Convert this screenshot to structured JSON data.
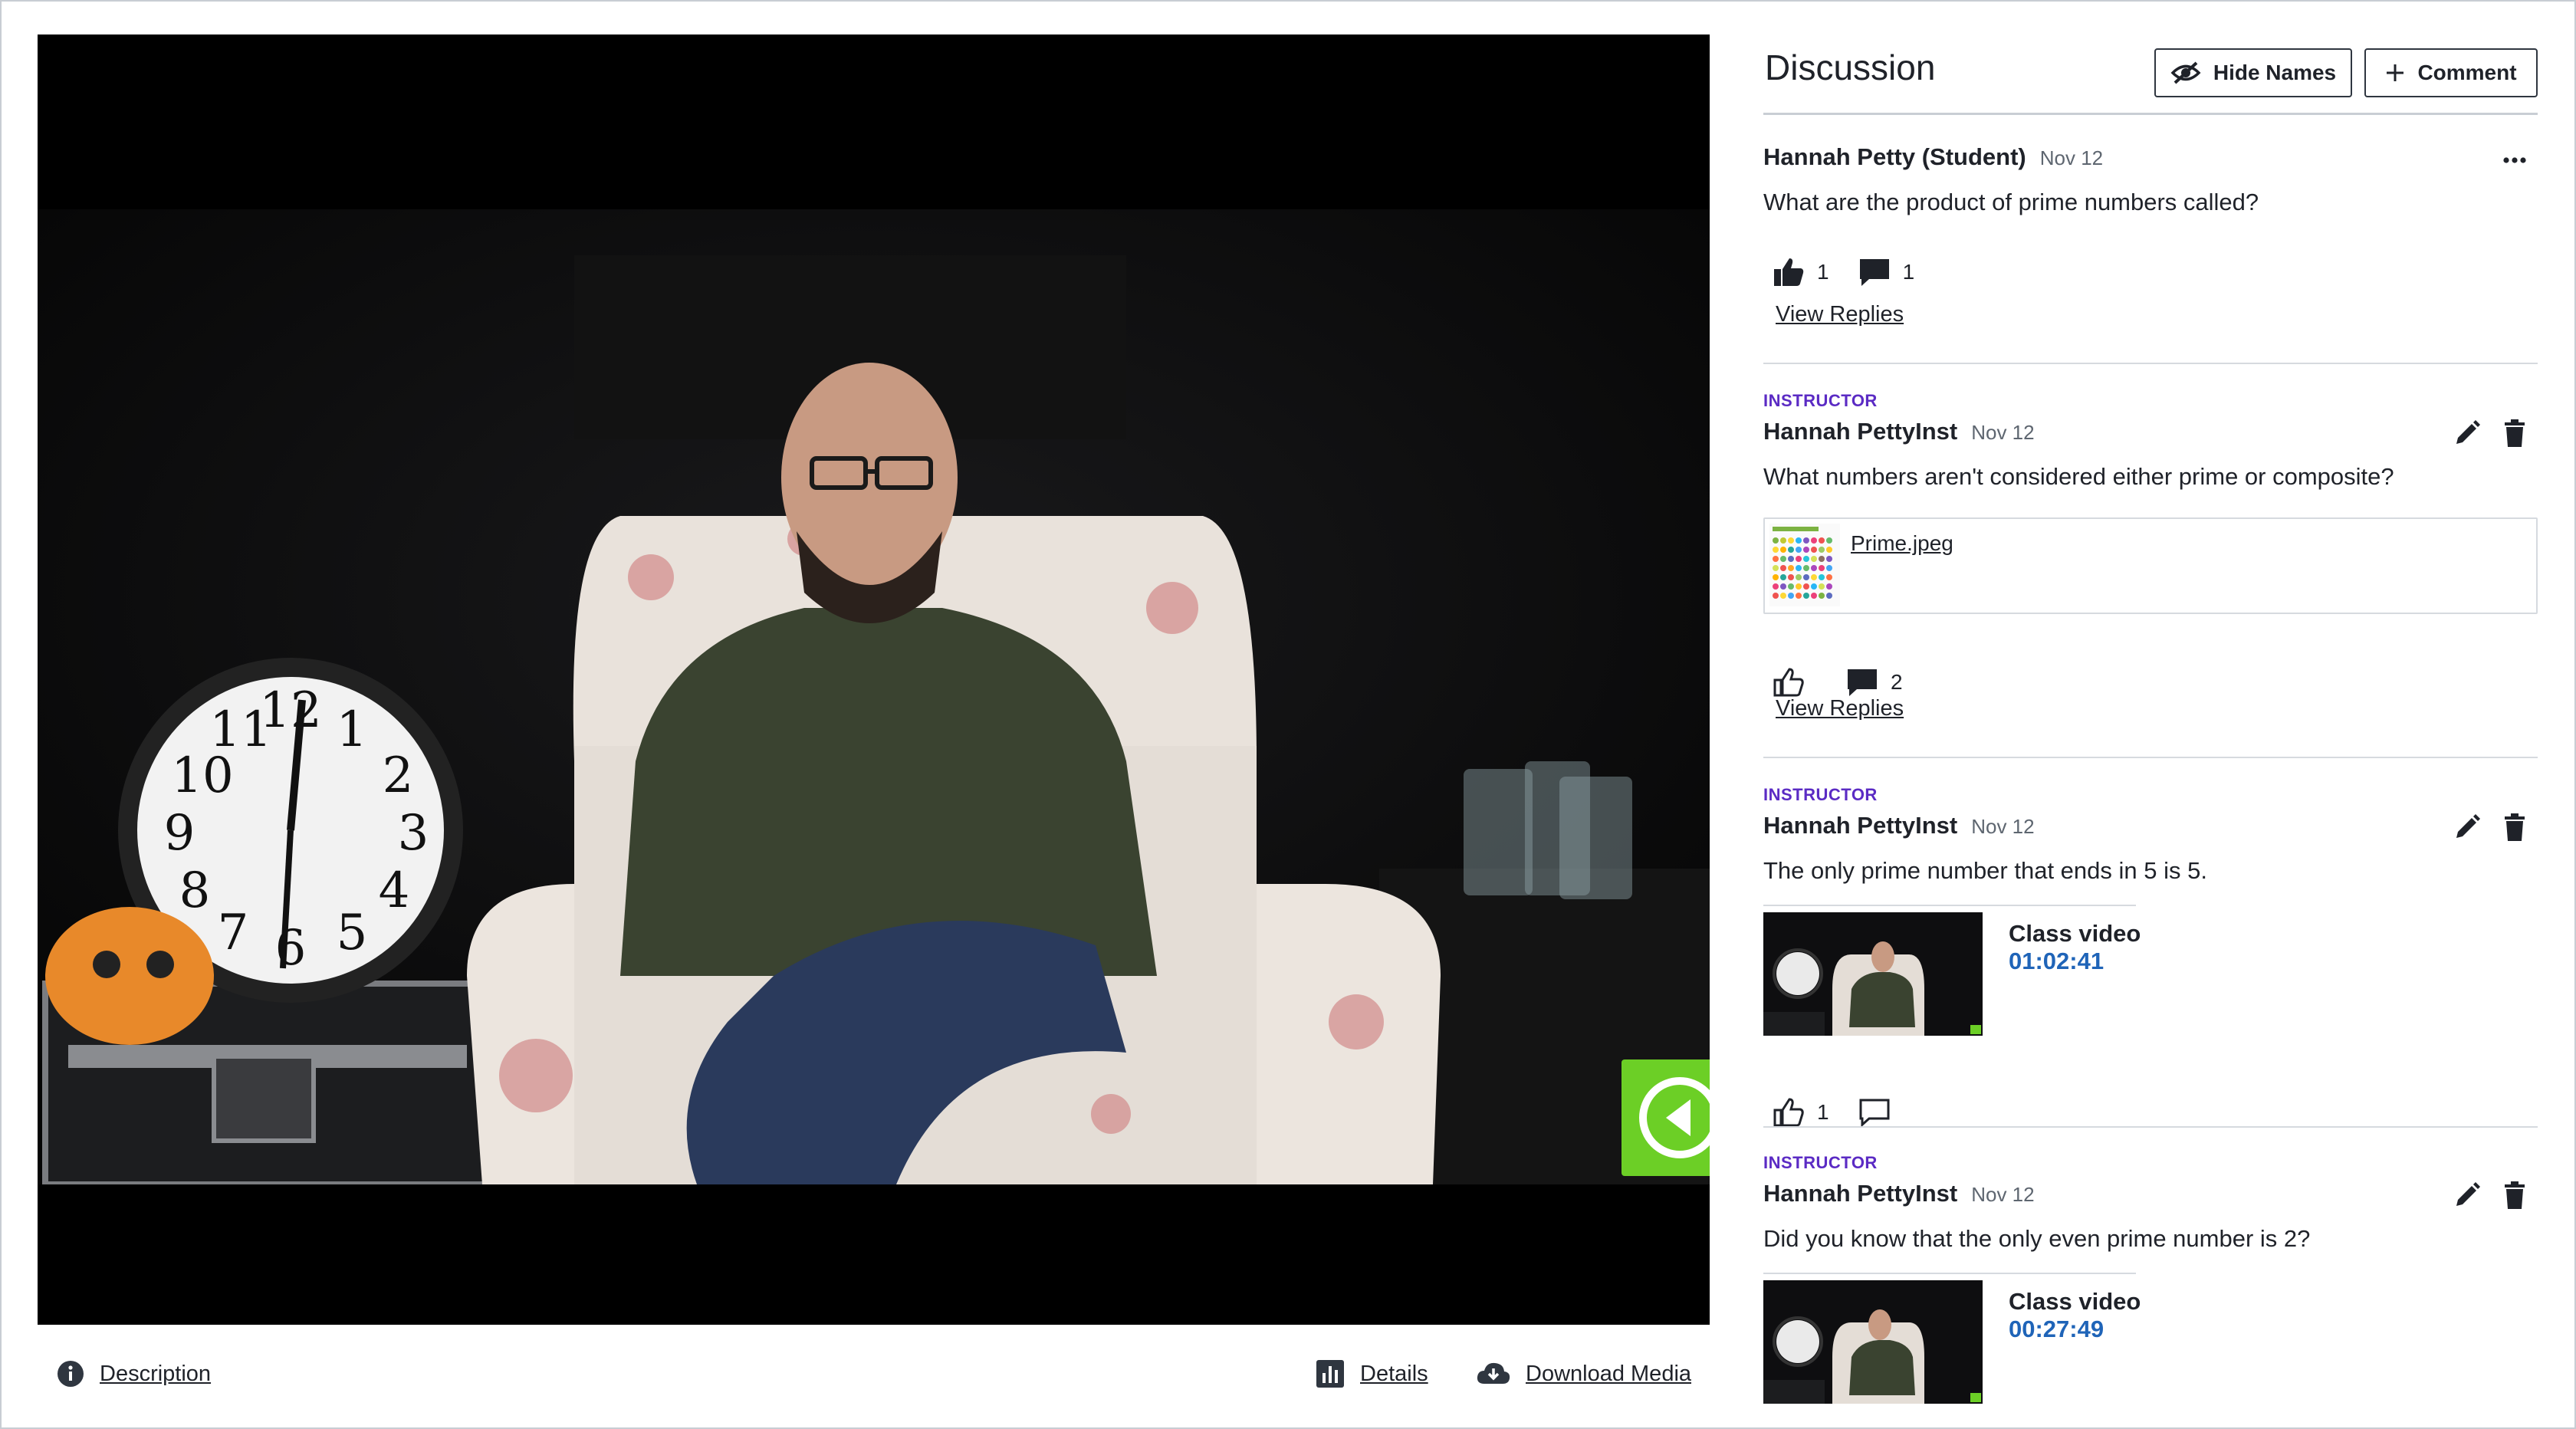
{
  "video": {
    "caption_toggle_icon": "arrow-left-circle-icon",
    "accent_color": "#6ccf26"
  },
  "media_links": {
    "description": "Description",
    "details": "Details",
    "download": "Download Media"
  },
  "discussion": {
    "title": "Discussion",
    "hide_names_label": "Hide Names",
    "comment_label": "Comment",
    "comments": [
      {
        "role": "",
        "author": "Hannah Petty (Student)",
        "date": "Nov 12",
        "text": "What are the product of prime numbers called?",
        "likes": "1",
        "replies": "1",
        "view_replies": "View Replies"
      },
      {
        "role": "INSTRUCTOR",
        "author": "Hannah PettyInst",
        "date": "Nov 12",
        "text": "What numbers aren't considered either prime or composite?",
        "attachment": "Prime.jpeg",
        "likes": "",
        "replies": "2",
        "view_replies": "View Replies"
      },
      {
        "role": "INSTRUCTOR",
        "author": "Hannah PettyInst",
        "date": "Nov 12",
        "text": "The only prime number that ends in 5 is 5.",
        "clip_title": "Class video",
        "clip_time": "01:02:41",
        "likes": "1",
        "replies": ""
      },
      {
        "role": "INSTRUCTOR",
        "author": "Hannah PettyInst",
        "date": "Nov 12",
        "text": "Did you know that the only even prime number is 2?",
        "clip_title": "Class video",
        "clip_time": "00:27:49"
      }
    ]
  }
}
